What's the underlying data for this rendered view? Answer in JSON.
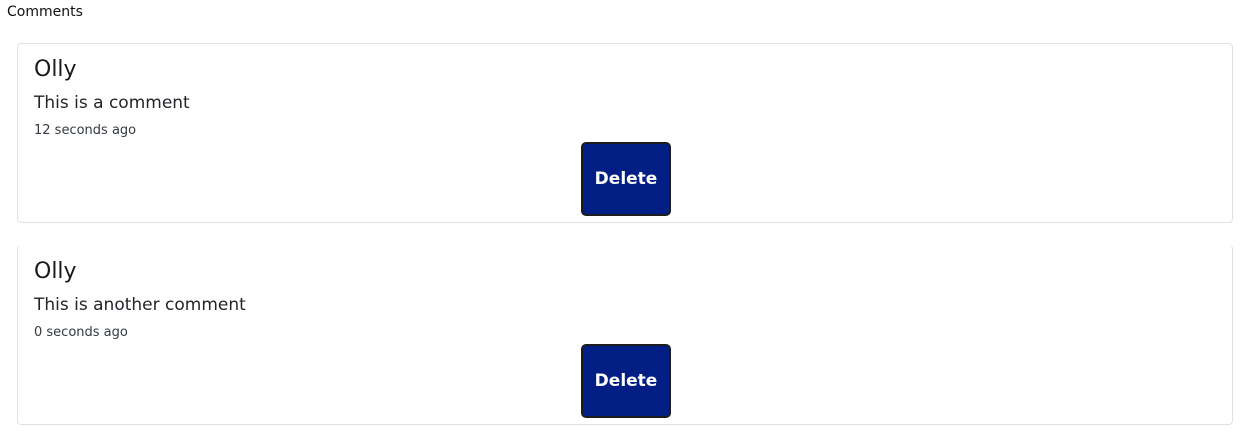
{
  "section": {
    "title": "Comments"
  },
  "comments": [
    {
      "author": "Olly",
      "text": "This is a comment",
      "time": "12 seconds ago",
      "delete_label": "Delete"
    },
    {
      "author": "Olly",
      "text": "This is another comment",
      "time": "0 seconds ago",
      "delete_label": "Delete"
    }
  ],
  "colors": {
    "delete_button_bg": "#001e84",
    "delete_button_text": "#ffffff",
    "card_border": "#dfe2e5"
  }
}
